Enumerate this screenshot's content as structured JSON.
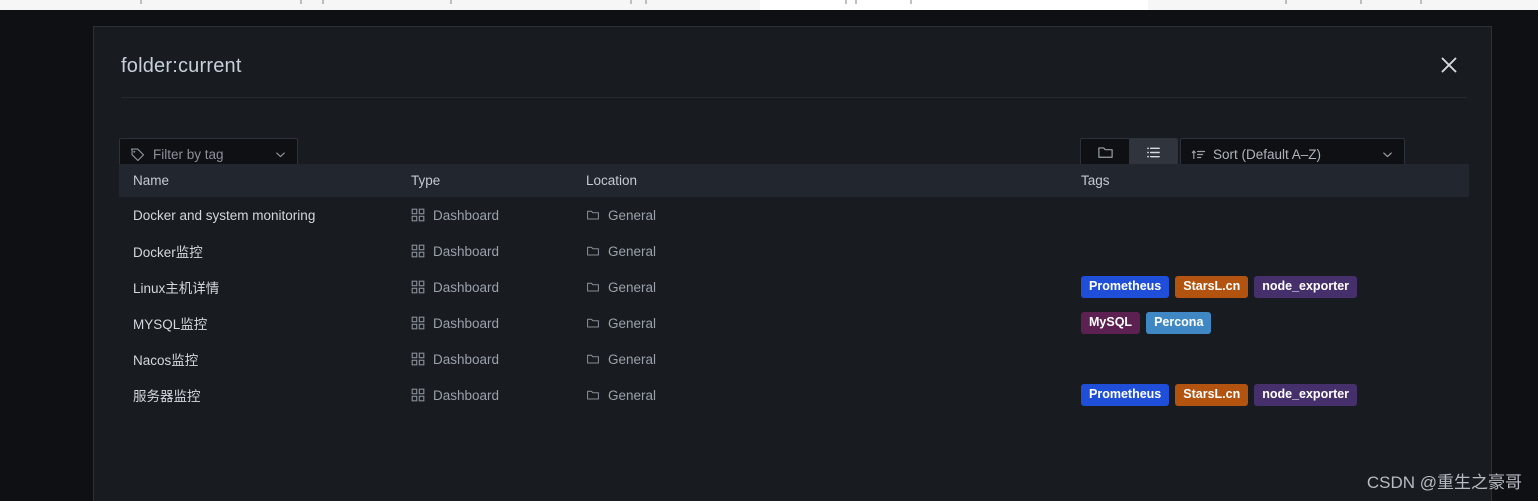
{
  "panel": {
    "title": "folder:current",
    "close_icon": "close-icon"
  },
  "toolbar": {
    "tag_filter": {
      "icon": "tag-icon",
      "placeholder": "Filter by tag",
      "chevron_icon": "chevron-down-icon"
    },
    "view_toggle": {
      "folder_view_icon": "folder-icon",
      "list_view_icon": "list-icon",
      "active": "list"
    },
    "sort": {
      "icon": "sort-ascending-icon",
      "value": "Sort (Default A–Z)",
      "chevron_icon": "chevron-down-icon"
    }
  },
  "table": {
    "columns": [
      "Name",
      "Type",
      "Location",
      "Tags"
    ],
    "rows": [
      {
        "name": "Docker and system monitoring",
        "type": "Dashboard",
        "location": "General",
        "tags": []
      },
      {
        "name": "Docker监控",
        "type": "Dashboard",
        "location": "General",
        "tags": []
      },
      {
        "name": "Linux主机详情",
        "type": "Dashboard",
        "location": "General",
        "tags": [
          {
            "label": "Prometheus",
            "color": "#1f4fd8"
          },
          {
            "label": "StarsL.cn",
            "color": "#b25410"
          },
          {
            "label": "node_exporter",
            "color": "#46306b"
          }
        ]
      },
      {
        "name": "MYSQL监控",
        "type": "Dashboard",
        "location": "General",
        "tags": [
          {
            "label": "MySQL",
            "color": "#5c2150"
          },
          {
            "label": "Percona",
            "color": "#4088c4"
          }
        ]
      },
      {
        "name": "Nacos监控",
        "type": "Dashboard",
        "location": "General",
        "tags": []
      },
      {
        "name": "服务器监控",
        "type": "Dashboard",
        "location": "General",
        "tags": [
          {
            "label": "Prometheus",
            "color": "#1f4fd8"
          },
          {
            "label": "StarsL.cn",
            "color": "#b25410"
          },
          {
            "label": "node_exporter",
            "color": "#46306b"
          }
        ]
      }
    ],
    "type_icon": "apps-grid-icon",
    "location_icon": "folder-icon"
  },
  "watermark": "CSDN @重生之豪哥"
}
